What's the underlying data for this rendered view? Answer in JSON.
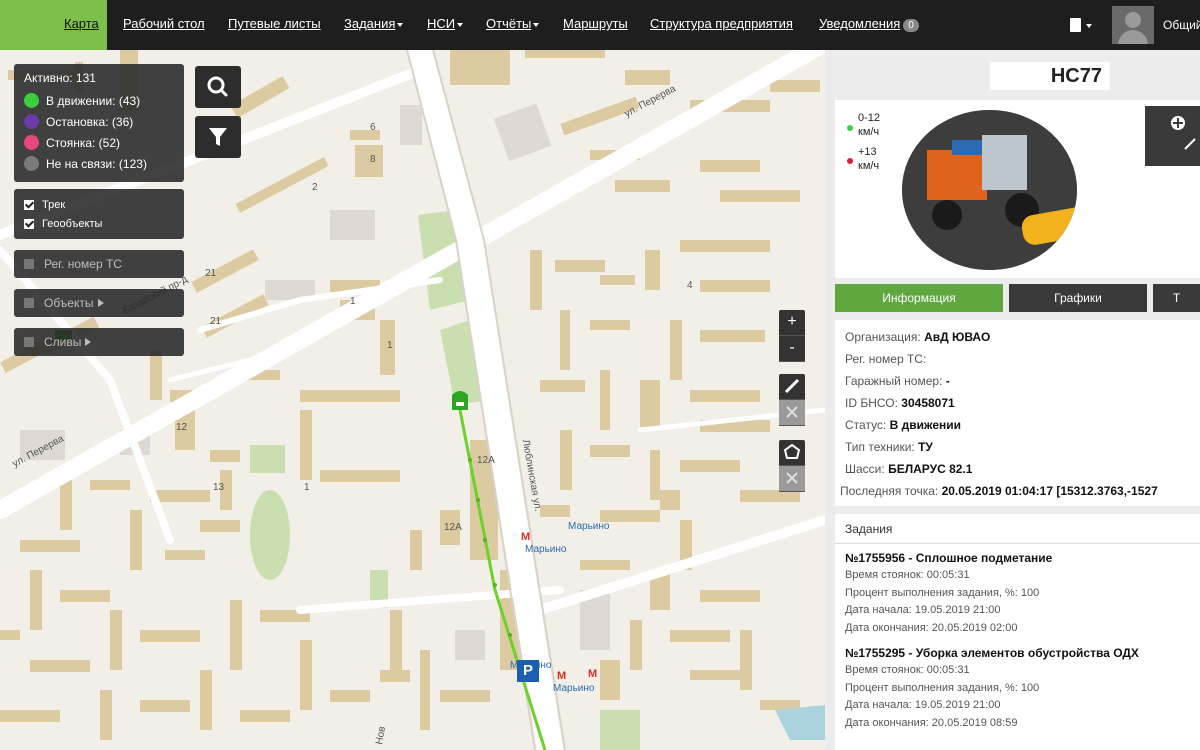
{
  "nav": {
    "items": [
      {
        "label": "Карта",
        "active": true
      },
      {
        "label": "Рабочий стол"
      },
      {
        "label": "Путевые листы"
      },
      {
        "label": "Задания",
        "dropdown": true
      },
      {
        "label": "НСИ",
        "dropdown": true
      },
      {
        "label": "Отчёты",
        "dropdown": true
      },
      {
        "label": "Маршруты"
      },
      {
        "label": "Структура предприятия"
      },
      {
        "label": "Уведомления"
      }
    ],
    "notification_count": "0",
    "user_name": "Общий"
  },
  "map": {
    "status": {
      "title": "Активно: 131",
      "rows": [
        {
          "label": "В движении: (43)",
          "color": "#3ccf3c"
        },
        {
          "label": "Остановка: (36)",
          "color": "#6b3aa6"
        },
        {
          "label": "Стоянка: (52)",
          "color": "#e8457a"
        },
        {
          "label": "Не на связи: (123)",
          "color": "#7a7a7a"
        }
      ]
    },
    "layers": [
      {
        "label": "Трек",
        "checked": true
      },
      {
        "label": "Геообъекты",
        "checked": true
      }
    ],
    "reg_filter_label": "Рег. номер ТС",
    "objects_label": "Объекты",
    "drains_label": "Сливы",
    "street_labels": {
      "perervy_top": "ул. Перерва",
      "perervy_left": "ул. Перерва",
      "lyublinskaya": "Люблинская ул.",
      "proezd": "Батайский пр-д",
      "bottom": "Нов"
    },
    "house_labels": [
      "6",
      "8",
      "2",
      "21",
      "1",
      "21",
      "1",
      "12",
      "12А",
      "13",
      "1",
      "12А",
      "4"
    ],
    "metro_label": "Марьино",
    "parking_label": "P",
    "zoom_in": "+",
    "zoom_out": "-"
  },
  "vehicle": {
    "title": "НС77",
    "speed_low": "0-12\nкм/ч",
    "speed_low_color": "#3ccf3c",
    "speed_high": "+13\nкм/ч",
    "speed_high_color": "#e01e3c"
  },
  "tabs": [
    "Информация",
    "Графики",
    "Т"
  ],
  "info": {
    "rows": [
      {
        "label": "Организация:",
        "value": "АвД ЮВАО"
      },
      {
        "label": "Рег. номер ТС:",
        "value": ""
      },
      {
        "label": "Гаражный номер:",
        "value": "-"
      },
      {
        "label": "ID БНСО:",
        "value": "30458071"
      },
      {
        "label": "Статус:",
        "value": "В движении"
      },
      {
        "label": "Тип техники:",
        "value": "ТУ"
      },
      {
        "label": "Шасси:",
        "value": "БЕЛАРУС 82.1"
      },
      {
        "label": "Последняя точка:",
        "value": "20.05.2019 01:04:17 [15312.3763,-1527"
      }
    ]
  },
  "tasks": {
    "header": "Задания",
    "items": [
      {
        "title": "№1755956 - Сплошное подметание",
        "lines": [
          "Время стоянок: 00:05:31",
          "Процент выполнения задания, %: 100",
          "Дата начала: 19.05.2019 21:00",
          "Дата окончания: 20.05.2019 02:00"
        ]
      },
      {
        "title": "№1755295 - Уборка элементов обустройства ОДХ",
        "lines": [
          "Время стоянок: 00:05:31",
          "Процент выполнения задания, %: 100",
          "Дата начала: 19.05.2019 21:00",
          "Дата окончания: 20.05.2019 08:59"
        ]
      }
    ]
  }
}
